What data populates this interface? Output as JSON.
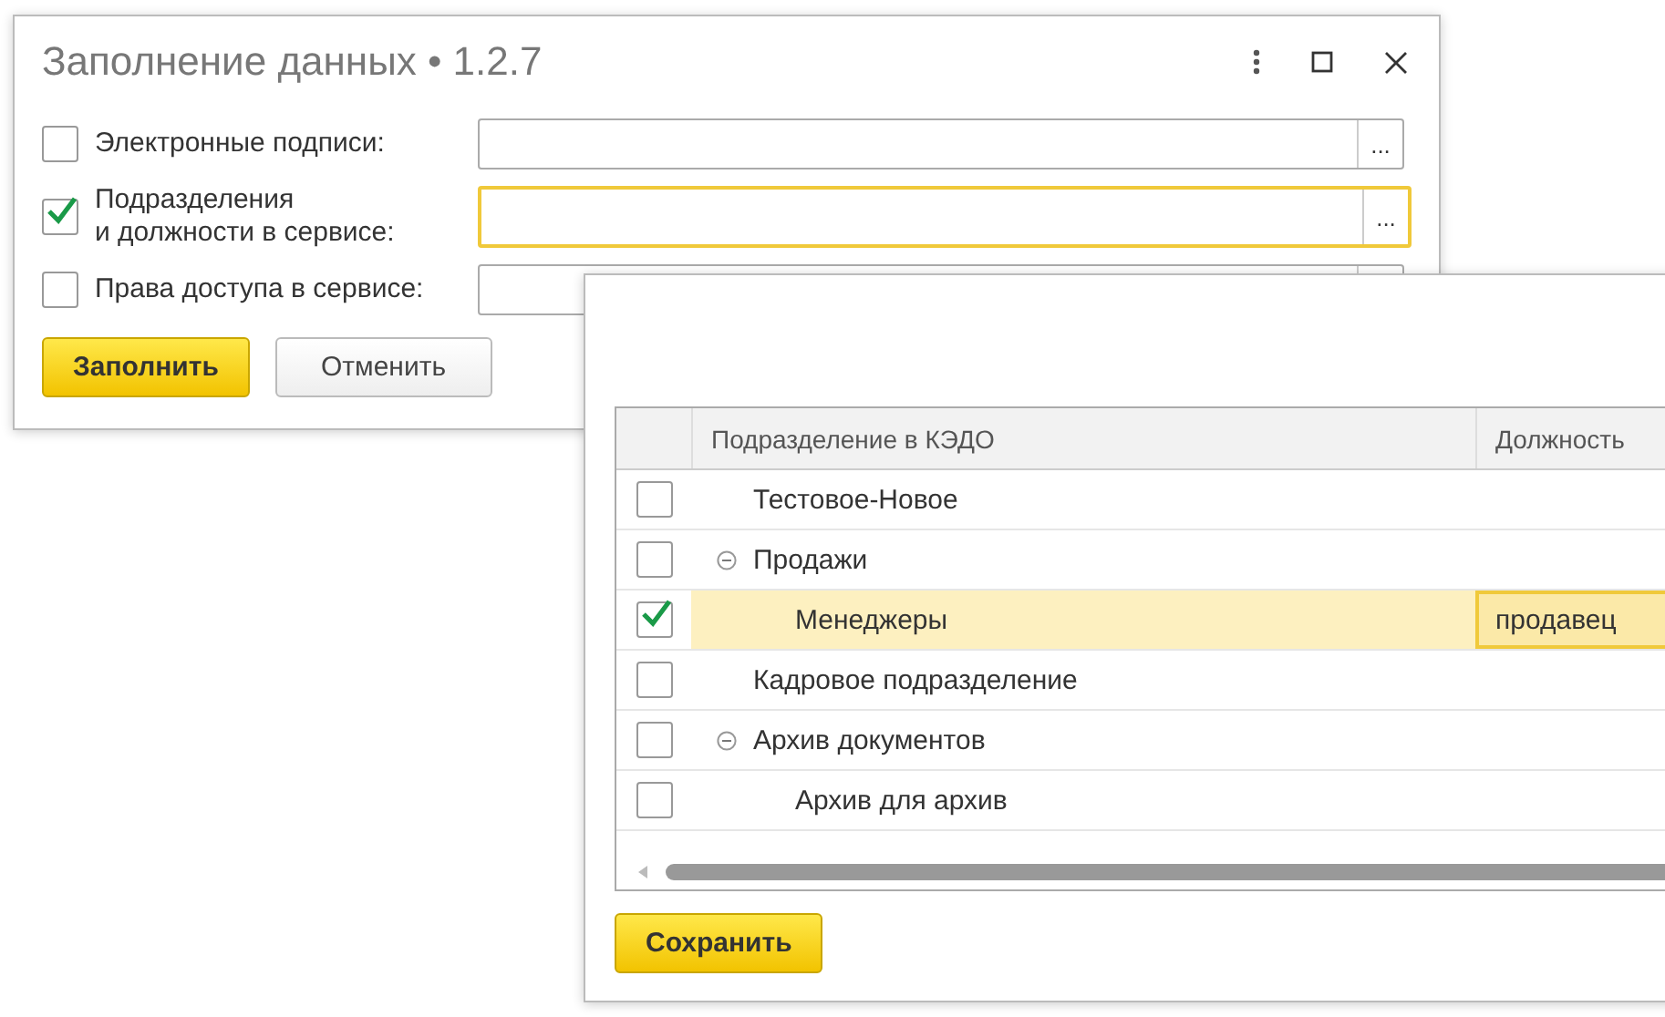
{
  "dialog": {
    "title": "Заполнение данных • 1.2.7",
    "options": [
      {
        "label": "Электронные подписи:",
        "checked": false,
        "focused": false
      },
      {
        "label": "Подразделения\nи должности в сервисе:",
        "checked": true,
        "focused": true
      },
      {
        "label": "Права доступа в сервисе:",
        "checked": false,
        "focused": false
      }
    ],
    "field_button": "...",
    "buttons": [
      {
        "label": "Заполнить",
        "kind": "primary"
      },
      {
        "label": "Отменить",
        "kind": "secondary"
      }
    ]
  },
  "tree_window": {
    "table": {
      "columns": [
        "Подразделение в КЭДО",
        "Должность"
      ],
      "rows": [
        {
          "name": "Тестовое-Новое",
          "checked": false,
          "selected": false
        },
        {
          "name": "Продажи",
          "checked": false,
          "selected": false,
          "expanded": true,
          "children": [
            {
              "name": "Менеджеры",
              "checked": true,
              "selected": true,
              "position": "продавец"
            }
          ]
        },
        {
          "name": "Кадровое подразделение",
          "checked": false,
          "selected": false
        },
        {
          "name": "Архив документов",
          "checked": false,
          "selected": false,
          "expanded": true,
          "children": [
            {
              "name": "Архив для архив",
              "checked": false,
              "selected": false
            }
          ]
        }
      ]
    },
    "buttons": [
      {
        "label": "Сохранить",
        "kind": "primary"
      }
    ]
  }
}
